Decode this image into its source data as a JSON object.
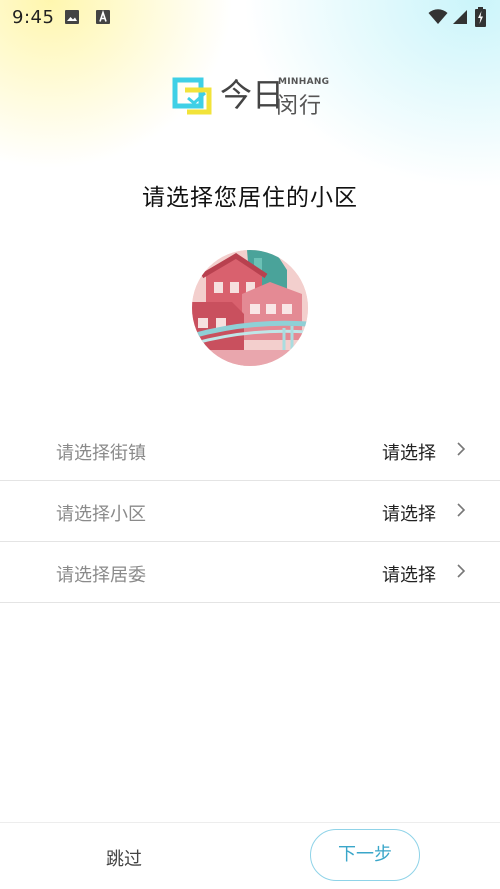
{
  "status_bar": {
    "time": "9:45",
    "icons": [
      "image-icon",
      "a-letter-icon",
      "wifi-icon",
      "signal-icon",
      "battery-charging-icon"
    ]
  },
  "logo": {
    "chinese_main": "今日",
    "english": "MINHANG",
    "chinese_sub": "闵行"
  },
  "page": {
    "title": "请选择您居住的小区"
  },
  "selectors": [
    {
      "label": "请选择街镇",
      "value": "请选择"
    },
    {
      "label": "请选择小区",
      "value": "请选择"
    },
    {
      "label": "请选择居委",
      "value": "请选择"
    }
  ],
  "footer": {
    "skip_label": "跳过",
    "next_label": "下一步"
  },
  "colors": {
    "accent": "#3aa6c9",
    "accent_border": "#8fd3e8",
    "logo_cyan": "#3fd0e6",
    "logo_yellow": "#f2e33a"
  }
}
